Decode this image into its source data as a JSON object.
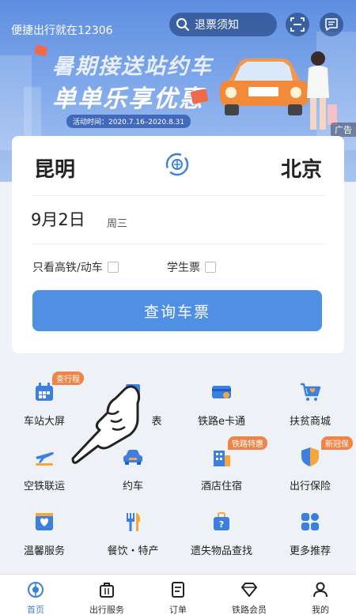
{
  "header": {
    "tagline": "便捷出行就在12306",
    "search_text": "退票须知",
    "scan_icon": "scan-icon",
    "message_icon": "message-icon"
  },
  "banner": {
    "line1": "暑期接送站约车",
    "line2": "单单乐享优惠",
    "date_range": "活动时间：2020.7.16–2020.8.31",
    "ad_tag": "广告"
  },
  "ticket": {
    "from_city": "昆明",
    "to_city": "北京",
    "date": "9月2日",
    "weekday": "周三",
    "option_high_speed": "只看高铁/动车",
    "option_student": "学生票",
    "query_button": "查询车票"
  },
  "grid": {
    "items": [
      {
        "label": "车站大屏",
        "icon": "station-screen-icon",
        "badge": "查行程"
      },
      {
        "label": "表",
        "icon": "timetable-icon",
        "badge": ""
      },
      {
        "label": "铁路e卡通",
        "icon": "e-card-icon",
        "badge": ""
      },
      {
        "label": "扶贫商城",
        "icon": "shopping-cart-icon",
        "badge": ""
      },
      {
        "label": "空铁联运",
        "icon": "air-rail-icon",
        "badge": ""
      },
      {
        "label": "约车",
        "icon": "car-icon",
        "badge": ""
      },
      {
        "label": "酒店住宿",
        "icon": "hotel-icon",
        "badge": "铁路特惠"
      },
      {
        "label": "出行保险",
        "icon": "insurance-icon",
        "badge": "新冠保"
      },
      {
        "label": "温馨服务",
        "icon": "service-icon",
        "badge": ""
      },
      {
        "label": "餐饮・特产",
        "icon": "dining-icon",
        "badge": ""
      },
      {
        "label": "遗失物品查找",
        "icon": "lost-found-icon",
        "badge": ""
      },
      {
        "label": "更多推荐",
        "icon": "more-icon",
        "badge": ""
      }
    ]
  },
  "nav": {
    "items": [
      {
        "label": "首页",
        "icon": "home-icon",
        "active": true
      },
      {
        "label": "出行服务",
        "icon": "travel-service-icon",
        "active": false
      },
      {
        "label": "订单",
        "icon": "order-icon",
        "active": false
      },
      {
        "label": "铁路会员",
        "icon": "member-icon",
        "active": false
      },
      {
        "label": "我的",
        "icon": "profile-icon",
        "active": false
      }
    ]
  },
  "colors": {
    "accent": "#5090e4",
    "badge": "#f08448",
    "nav_active": "#3b7fe0"
  }
}
